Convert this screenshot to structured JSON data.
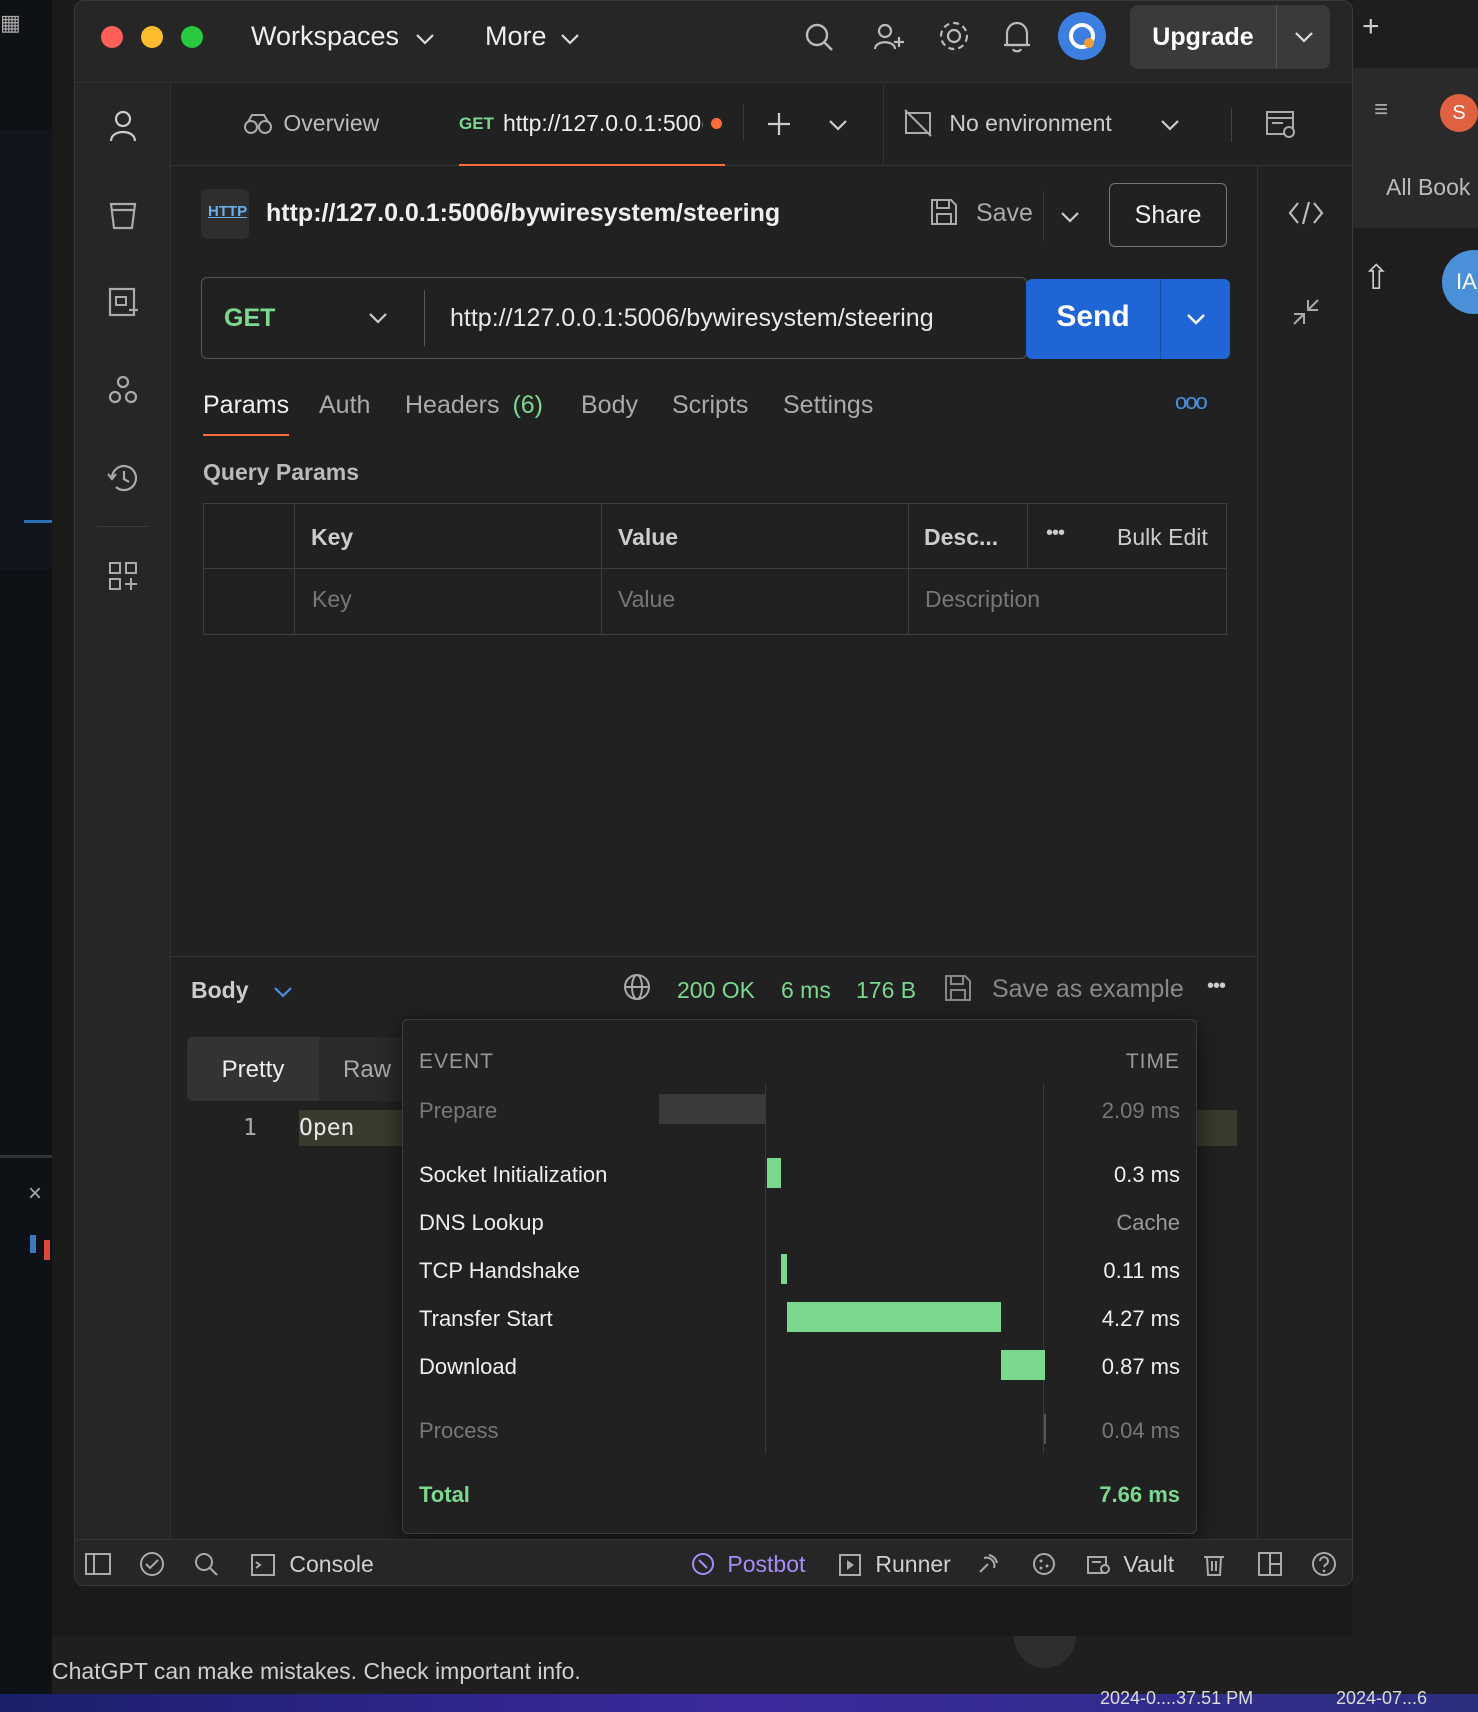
{
  "titlebar": {
    "workspaces_label": "Workspaces",
    "more_label": "More",
    "upgrade_label": "Upgrade"
  },
  "tabs": {
    "overview_label": "Overview",
    "active_method": "GET",
    "active_url": "http://127.0.0.1:500(",
    "environment_label": "No environment"
  },
  "request": {
    "protocol_badge": "HTTP",
    "title": "http://127.0.0.1:5006/bywiresystem/steering",
    "save_label": "Save",
    "share_label": "Share",
    "method": "GET",
    "url": "http://127.0.0.1:5006/bywiresystem/steering",
    "send_label": "Send",
    "subtabs": [
      "Params",
      "Auth",
      "Headers",
      "Body",
      "Scripts",
      "Settings"
    ],
    "headers_count": "(6)",
    "query_params_title": "Query Params",
    "table_headers": {
      "key": "Key",
      "value": "Value",
      "description": "Desc...",
      "bulk_edit": "Bulk Edit"
    },
    "table_placeholders": {
      "key": "Key",
      "value": "Value",
      "description": "Description"
    }
  },
  "response": {
    "body_label": "Body",
    "status": "200 OK",
    "time": "6 ms",
    "size": "176 B",
    "save_example_label": "Save as example",
    "view_tabs": [
      "Pretty",
      "Raw"
    ],
    "line_number": "1",
    "line_text": "Open"
  },
  "timing": {
    "event_header": "EVENT",
    "time_header": "TIME",
    "rows": [
      {
        "event": "Prepare",
        "time": "2.09 ms"
      },
      {
        "event": "Socket Initialization",
        "time": "0.3 ms"
      },
      {
        "event": "DNS Lookup",
        "time": "Cache"
      },
      {
        "event": "TCP Handshake",
        "time": "0.11 ms"
      },
      {
        "event": "Transfer Start",
        "time": "4.27 ms"
      },
      {
        "event": "Download",
        "time": "0.87 ms"
      },
      {
        "event": "Process",
        "time": "0.04 ms"
      }
    ],
    "total_label": "Total",
    "total_time": "7.66 ms"
  },
  "footer": {
    "console_label": "Console",
    "postbot_label": "Postbot",
    "runner_label": "Runner",
    "vault_label": "Vault"
  },
  "background": {
    "right_label": "All Book",
    "right_avatar_s": "S",
    "right_avatar_ia": "IA",
    "bottom_notice": "ChatGPT can make mistakes. Check important info.",
    "taskbar_left": "2024-0....37.51 PM",
    "taskbar_right": "2024-07...6"
  },
  "colors": {
    "accent_send": "#1f65d6",
    "success_green": "#7bd88f",
    "tab_underline": "#ff6c37",
    "unsaved_dot": "#ff6c37"
  }
}
